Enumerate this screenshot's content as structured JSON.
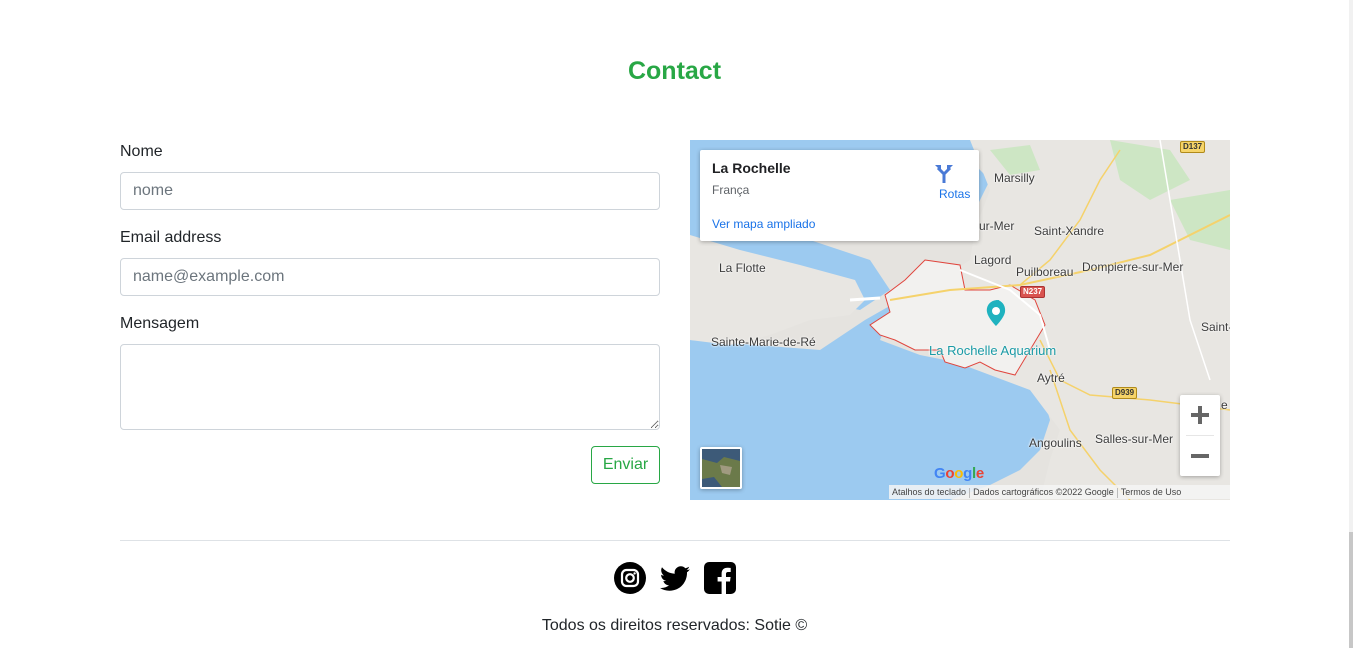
{
  "section": {
    "title": "Contact",
    "title_color": "#28a745"
  },
  "form": {
    "name_label": "Nome",
    "name_placeholder": "nome",
    "email_label": "Email address",
    "email_placeholder": "name@example.com",
    "message_label": "Mensagem",
    "message_placeholder": "",
    "submit_label": "Enviar"
  },
  "map": {
    "info_card": {
      "title": "La Rochelle",
      "subtitle": "França",
      "larger_map_link": "Ver mapa ampliado",
      "directions_label": "Rotas",
      "directions_icon": "directions-icon"
    },
    "places": {
      "marsilly": "Marsilly",
      "saint_xandre": "Saint-Xandre",
      "lagord": "Lagord",
      "puilboreau": "Puilboreau",
      "dompierre": "Dompierre-sur-Mer",
      "la_flotte": "La Flotte",
      "sainte_marie": "Sainte-Marie-de-Ré",
      "aytre": "Aytré",
      "angoulins": "Angoulins",
      "salles": "Salles-sur-Mer",
      "saint_partial": "Saint-",
      "ur_mer_partial": "ur-Mer",
      "e_partial": "e"
    },
    "road_badges": {
      "d137": "D137",
      "n237": "N237",
      "d939": "D939"
    },
    "poi": {
      "label": "La Rochelle Aquarium",
      "icon": "aquarium-pin-icon"
    },
    "controls": {
      "zoom_in": "+",
      "zoom_out": "−"
    },
    "logo": "Google",
    "attribution": {
      "shortcuts": "Atalhos do teclado",
      "data": "Dados cartográficos ©2022 Google",
      "terms": "Termos de Uso"
    }
  },
  "footer": {
    "social": [
      "instagram-icon",
      "twitter-icon",
      "facebook-icon"
    ],
    "copyright": "Todos os direitos reservados: Sotie ©"
  }
}
